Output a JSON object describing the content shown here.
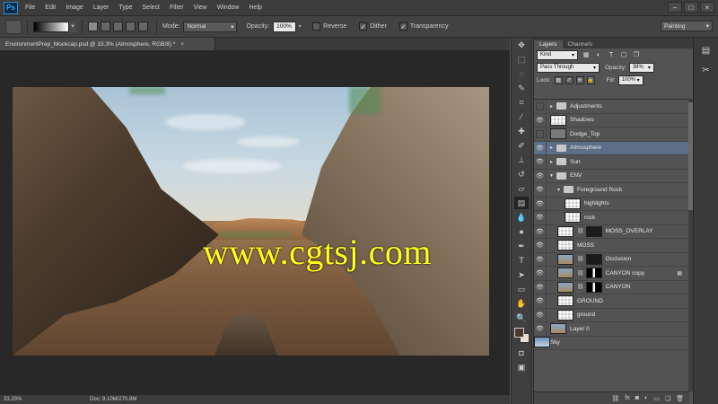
{
  "app": {
    "logo": "Ps",
    "menu": [
      "File",
      "Edit",
      "Image",
      "Layer",
      "Type",
      "Select",
      "Filter",
      "View",
      "Window",
      "Help"
    ],
    "window_controls": [
      "–",
      "□",
      "×"
    ]
  },
  "options_bar": {
    "mode_label": "Mode:",
    "mode_value": "Normal",
    "opacity_label": "Opacity:",
    "opacity_value": "100%",
    "reverse_label": "Reverse",
    "dither_label": "Dither",
    "transparency_label": "Transparency",
    "reverse_checked": false,
    "dither_checked": true,
    "transparency_checked": true,
    "workspace": "Painting"
  },
  "document": {
    "tab_title": "EnvironmentPrep_Mockcap.psd @ 33.3% (Atmosphere, RGB/8) *",
    "watermark": "www.cgtsj.com"
  },
  "status_bar": {
    "zoom": "33.33%",
    "doc_size": "Doc: 9.10M/270.9M"
  },
  "layers_panel": {
    "tabs": [
      "Layers",
      "Channels"
    ],
    "filter_kind": "Kind",
    "blend_mode": "Pass Through",
    "opacity_label": "Opacity:",
    "opacity_value": "38%",
    "lock_label": "Lock:",
    "fill_label": "Fill:",
    "fill_value": "100%",
    "layers": [
      {
        "name": "Adjustments",
        "type": "group",
        "visible": false,
        "indent": 0,
        "expanded": false
      },
      {
        "name": "Shadows",
        "type": "layer",
        "thumb": "checker",
        "visible": true,
        "indent": 0
      },
      {
        "name": "Dodge_Top",
        "type": "layer",
        "thumb": "gray",
        "visible": false,
        "indent": 0
      },
      {
        "name": "Atmosphere",
        "type": "group",
        "visible": true,
        "indent": 0,
        "expanded": false,
        "selected": true
      },
      {
        "name": "Sun",
        "type": "group",
        "visible": true,
        "indent": 0,
        "expanded": false
      },
      {
        "name": "ENV",
        "type": "group",
        "visible": true,
        "indent": 0,
        "expanded": true
      },
      {
        "name": "Foreground Rock",
        "type": "group",
        "visible": true,
        "indent": 1,
        "expanded": true
      },
      {
        "name": "highlights",
        "type": "layer",
        "thumb": "checker",
        "visible": true,
        "indent": 2
      },
      {
        "name": "rock",
        "type": "layer",
        "thumb": "checker",
        "visible": true,
        "indent": 2
      },
      {
        "name": "MOSS_OVERLAY",
        "type": "layer",
        "thumb": "checker",
        "mask": "dark",
        "visible": true,
        "indent": 1
      },
      {
        "name": "MOSS",
        "type": "layer",
        "thumb": "checker",
        "visible": true,
        "indent": 1
      },
      {
        "name": "Occlusion",
        "type": "layer",
        "thumb": "photo",
        "mask": "dark",
        "visible": true,
        "indent": 1
      },
      {
        "name": "CANYON copy",
        "type": "layer",
        "thumb": "photo",
        "mask": "mask",
        "visible": true,
        "indent": 1,
        "fx": true
      },
      {
        "name": "CANYON",
        "type": "layer",
        "thumb": "photo",
        "mask": "mask",
        "visible": true,
        "indent": 1
      },
      {
        "name": "GROUND",
        "type": "layer",
        "thumb": "checker",
        "visible": true,
        "indent": 1
      },
      {
        "name": "ground",
        "type": "layer",
        "thumb": "checker",
        "visible": true,
        "indent": 1
      },
      {
        "name": "Layer 0",
        "type": "layer",
        "thumb": "photo",
        "visible": true,
        "indent": 0
      },
      {
        "name": "Sky",
        "type": "layer",
        "thumb": "sky",
        "visible": true,
        "indent": 0
      }
    ],
    "footer_buttons": [
      "link-icon",
      "fx-icon",
      "mask-icon",
      "adjustment-icon",
      "folder-icon",
      "new-layer-icon",
      "trash-icon"
    ]
  },
  "colors": {
    "foreground": "#4b3a2b",
    "background": "#e7dfd4",
    "selection": "#5d6f87"
  }
}
